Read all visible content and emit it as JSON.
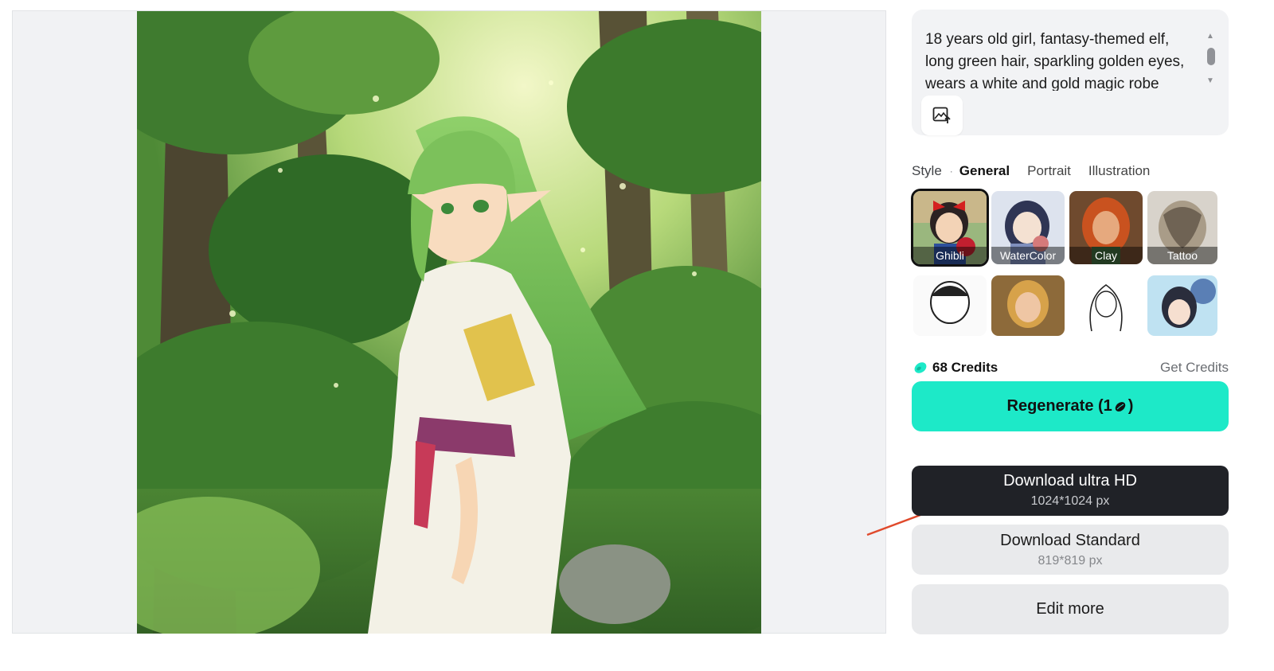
{
  "prompt": {
    "text": "18 years old girl, fantasy-themed elf, long green hair, sparkling golden eyes, wears a white and gold magic robe",
    "upload_icon": "image-upload-icon"
  },
  "style": {
    "label": "Style",
    "tabs": [
      "General",
      "Portrait",
      "Illustration"
    ],
    "active_tab": "General",
    "items": [
      {
        "label": "Ghibli",
        "selected": true
      },
      {
        "label": "WaterColor",
        "selected": false
      },
      {
        "label": "Clay",
        "selected": false
      },
      {
        "label": "Tattoo",
        "selected": false
      }
    ]
  },
  "credits": {
    "value": "68 Credits",
    "get_label": "Get Credits",
    "icon": "credit-coin-icon",
    "color": "#1de9c8"
  },
  "actions": {
    "regenerate_label": "Regenerate (1",
    "regenerate_suffix": ")",
    "regenerate_color": "#1de9c8",
    "ultra_label": "Download ultra HD",
    "ultra_size": "1024*1024 px",
    "standard_label": "Download Standard",
    "standard_size": "819*819 px",
    "edit_label": "Edit more"
  }
}
